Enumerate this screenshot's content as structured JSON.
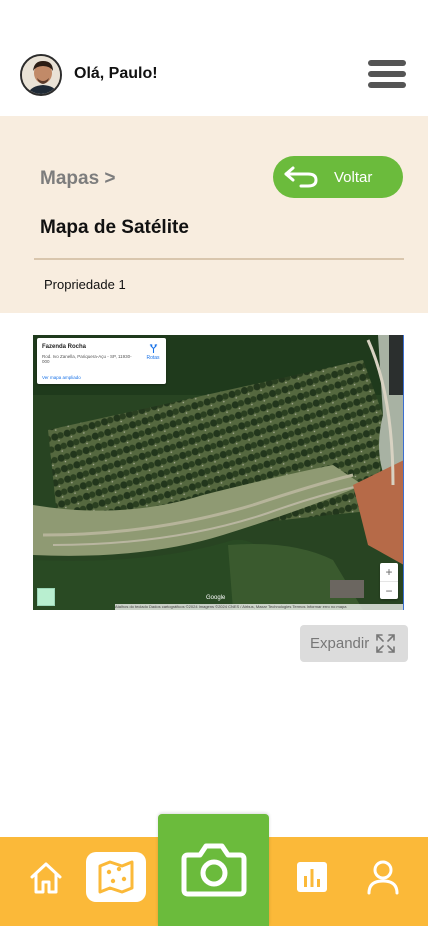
{
  "header": {
    "greeting": "Olá, Paulo!",
    "avatar_icon": "user-avatar-photo",
    "menu_icon": "hamburger-menu-icon"
  },
  "section": {
    "breadcrumb": "Mapas >",
    "back_button_label": "Voltar",
    "back_icon": "return-arrow-icon",
    "title": "Mapa de Satélite",
    "property_label": "Propriedade 1"
  },
  "map": {
    "place_name": "Fazenda Rocha",
    "address": "Rod. Ivo Zanella, Pariquera-Açu - SP, 11930-000",
    "route_label": "Rotas",
    "enlarge_link": "Ver mapa ampliado",
    "zoom_in": "+",
    "zoom_out": "−",
    "logo": "Google",
    "attribution": "Atalhos do teclado   Dados cartográficos ©2024 Imagens ©2024 CNES / Airbus, Maxar Technologies   Termos   Informar erro no mapa"
  },
  "expand_button": {
    "label": "Expandir",
    "icon": "expand-arrows-icon"
  },
  "bottom_nav": {
    "items": [
      "home-icon",
      "map-icon",
      "camera-icon",
      "chart-icon",
      "user-icon"
    ],
    "active": "map-icon"
  },
  "colors": {
    "accent_green": "#6bbb3c",
    "nav_orange": "#fbb939",
    "section_bg": "#f8eddf"
  }
}
